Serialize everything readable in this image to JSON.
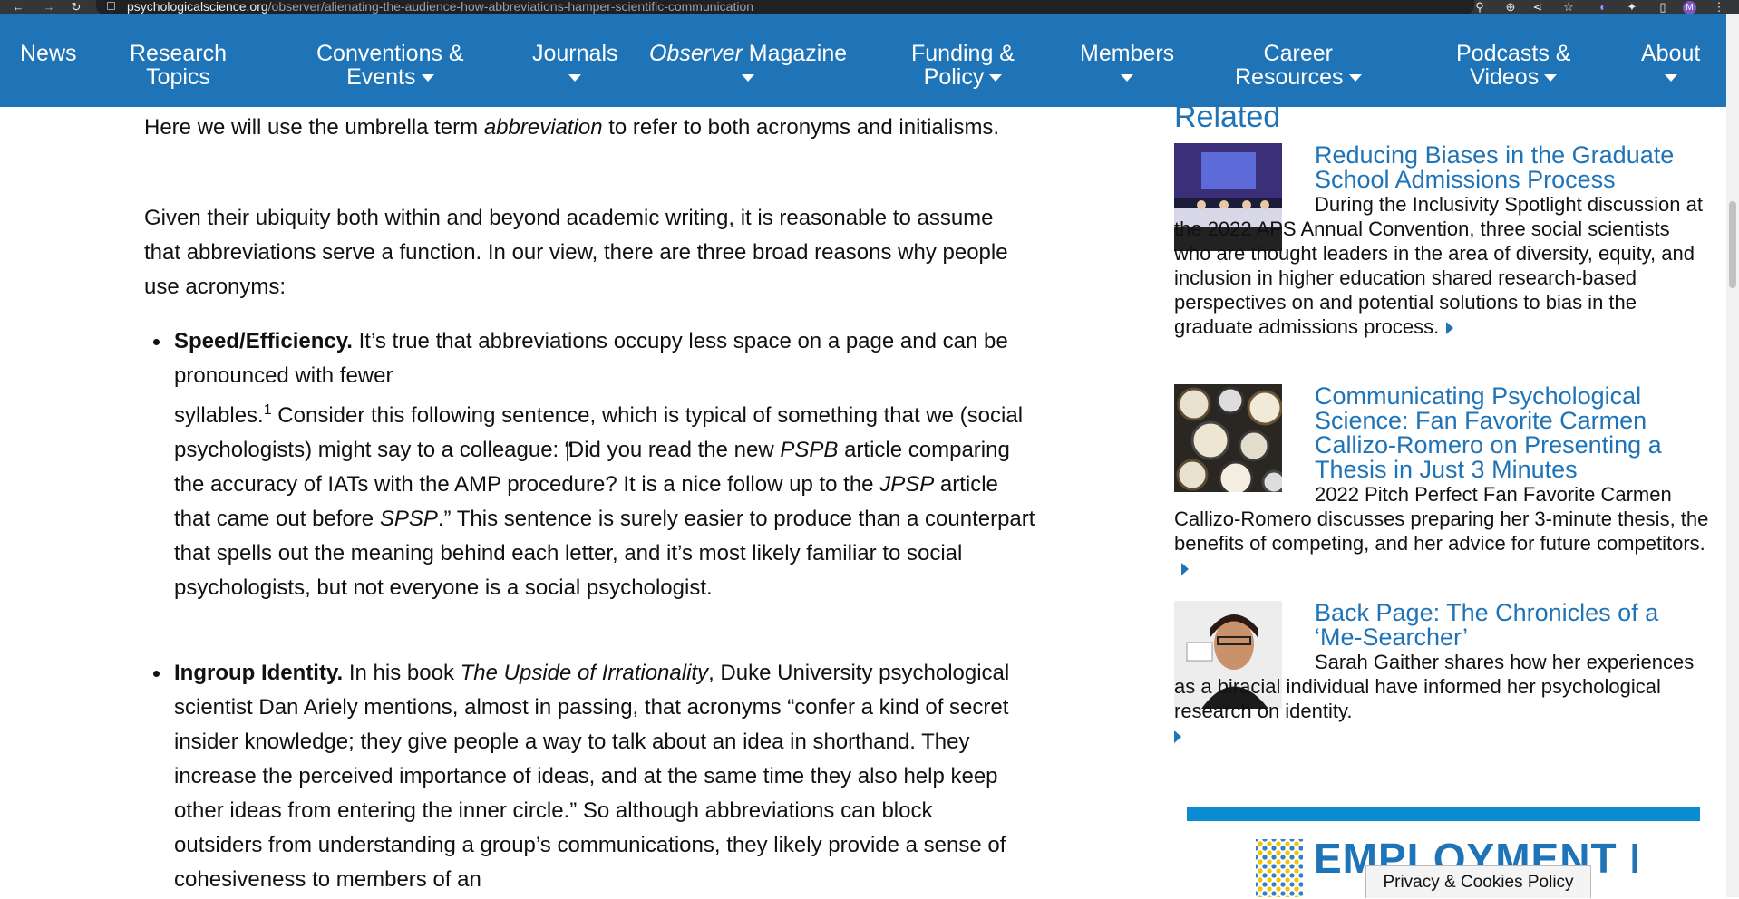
{
  "browser": {
    "url_domain": "psychologicalscience.org",
    "url_path": "/observer/alienating-the-audience-how-abbreviations-hamper-scientific-communication",
    "back_icon": "arrow-left-icon",
    "forward_icon": "arrow-right-icon",
    "reload_icon": "reload-icon",
    "profile_initial": "M"
  },
  "nav": {
    "items": [
      {
        "line1": "News",
        "line2": ""
      },
      {
        "line1": "Research",
        "line2": "Topics"
      },
      {
        "line1": "Conventions &",
        "line2": "Events"
      },
      {
        "line1": "Journals",
        "line2": ""
      },
      {
        "line1": "Observer",
        "line1_rest": " Magazine",
        "line2": ""
      },
      {
        "line1": "Funding &",
        "line2": "Policy"
      },
      {
        "line1": "Members",
        "line2": ""
      },
      {
        "line1": "Career",
        "line2": "Resources"
      },
      {
        "line1": "Podcasts &",
        "line2": "Videos"
      },
      {
        "line1": "About",
        "line2": ""
      }
    ],
    "brand_color": "#1f73b7"
  },
  "article": {
    "p1_a": "Here we will use the umbrella term ",
    "p1_em": "abbreviation",
    "p1_b": " to refer to both acronyms and initialisms.",
    "p2": "Given their ubiquity both within and beyond academic writing, it is reasonable to assume that abbreviations serve a function. In our view, there are three broad reasons why people use acronyms:",
    "b1_strong": "Speed/Efficiency.",
    "b1_a": " It’s true that abbreviations occupy less space on a page and can be pronounced with fewer",
    "b1_b": "syllables.",
    "b1_sup": "1",
    "b1_c": " Consider this following sentence, which is typical of something that we (social psychologists) might say to a colleague: “",
    "b1_d": "Did you read the new ",
    "b1_em1": "PSPB",
    "b1_e": " article comparing the accuracy of IATs with the AMP procedure? It is a nice follow up to the ",
    "b1_em2": "JPSP",
    "b1_f": " article that came out before ",
    "b1_em3": "SPSP",
    "b1_g": ".” This sentence is surely easier to produce than a counterpart that spells out the meaning behind each letter, and it’s most likely familiar to social psychologists, but not everyone is a social psychologist.",
    "b2_strong": "Ingroup Identity.",
    "b2_a": " In his book ",
    "b2_em": "The Upside of Irrationality",
    "b2_b": ", Duke University psychological scientist Dan Ariely mentions, almost in passing, that acronyms “confer a kind of secret insider knowledge; they give people a way to talk about an idea in shorthand. They increase the perceived importance of ideas, and at the same time they also help keep other ideas from entering the inner circle.” So although abbreviations can block outsiders from understanding a group’s communications, they likely provide a sense of cohesiveness to members of an"
  },
  "sidebar": {
    "title": "Related",
    "items": [
      {
        "title": "Reducing Biases in the Graduate School Admissions Process",
        "desc": "During the Inclusivity Spotlight discussion at the 2022 APS Annual Convention, three social scientists who are thought leaders in the area of diversity, equity, and inclusion in higher education shared research-based perspectives on and potential solutions to bias in the graduate admissions process."
      },
      {
        "title": "Communicating Psychological Science: Fan Favorite Carmen Callizo-Romero on Presenting a Thesis in Just 3 Minutes",
        "desc": "2022 Pitch Perfect Fan Favorite Carmen Callizo-Romero discusses preparing her 3-minute thesis, the benefits of competing, and her advice for future competitors."
      },
      {
        "title": "Back Page: The Chronicles of a ‘Me-Searcher’",
        "desc": "Sarah Gaither shares how her experiences as a biracial individual have informed her psychological research on identity."
      }
    ],
    "employment_banner": "EMPLOYMENT NE"
  },
  "privacy_label": "Privacy & Cookies Policy"
}
